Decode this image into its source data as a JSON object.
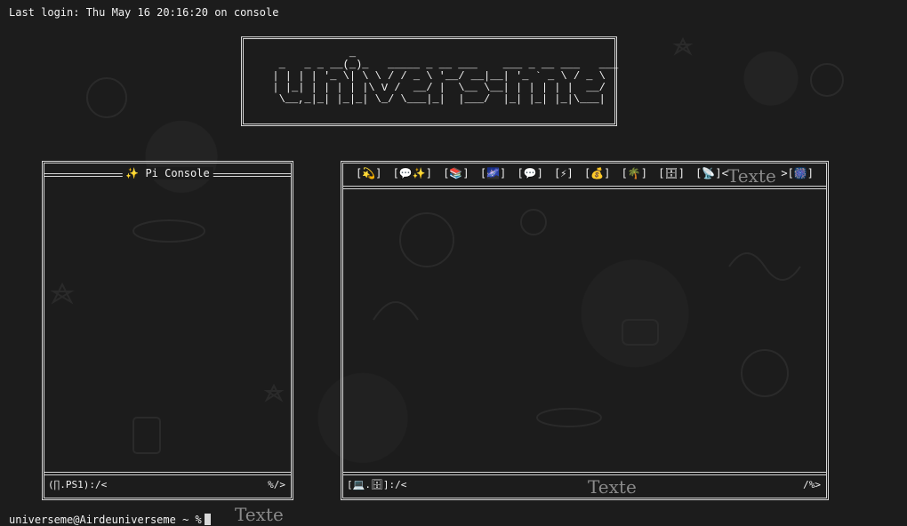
{
  "terminal": {
    "login_line": "Last login: Thu May 16 20:16:20 on console",
    "prompt_line": "universeme@Airdeuniverseme ~ %"
  },
  "banner": {
    "ascii_art": "              _\n   _   _ _ __(_)_   _____ _ __ ___    ___ _ __ ___   ___\n  | | | | '_ \\| \\ \\ / / _ \\ '__/ __|__| '_ ` _ \\ / _ \\\n  | |_| | | | | |\\ V /  __/ |  \\__ \\__| | | | | |  __/\n   \\__,_|_| |_|_| \\_/ \\___|_|  |___/  |_| |_| |_|\\___|"
  },
  "left_pane": {
    "title": "✨ Pi Console",
    "status_left": "(∏.PS1):/<",
    "status_right": "%/>"
  },
  "right_pane": {
    "tabs": [
      "[💫]",
      "[💬✨]",
      "[📚]",
      "[🌌]",
      "[💬]",
      "[⚡]",
      "[💰]",
      "[🌴]",
      "[🗄]",
      "[📡]<"
    ],
    "tabs_end": ">[🎆]",
    "status_left": "[💻.🗄]:/<",
    "status_right": "/%>"
  },
  "overlays": {
    "texte_1": "Texte",
    "texte_2": "Texte",
    "texte_3": "Texte"
  }
}
